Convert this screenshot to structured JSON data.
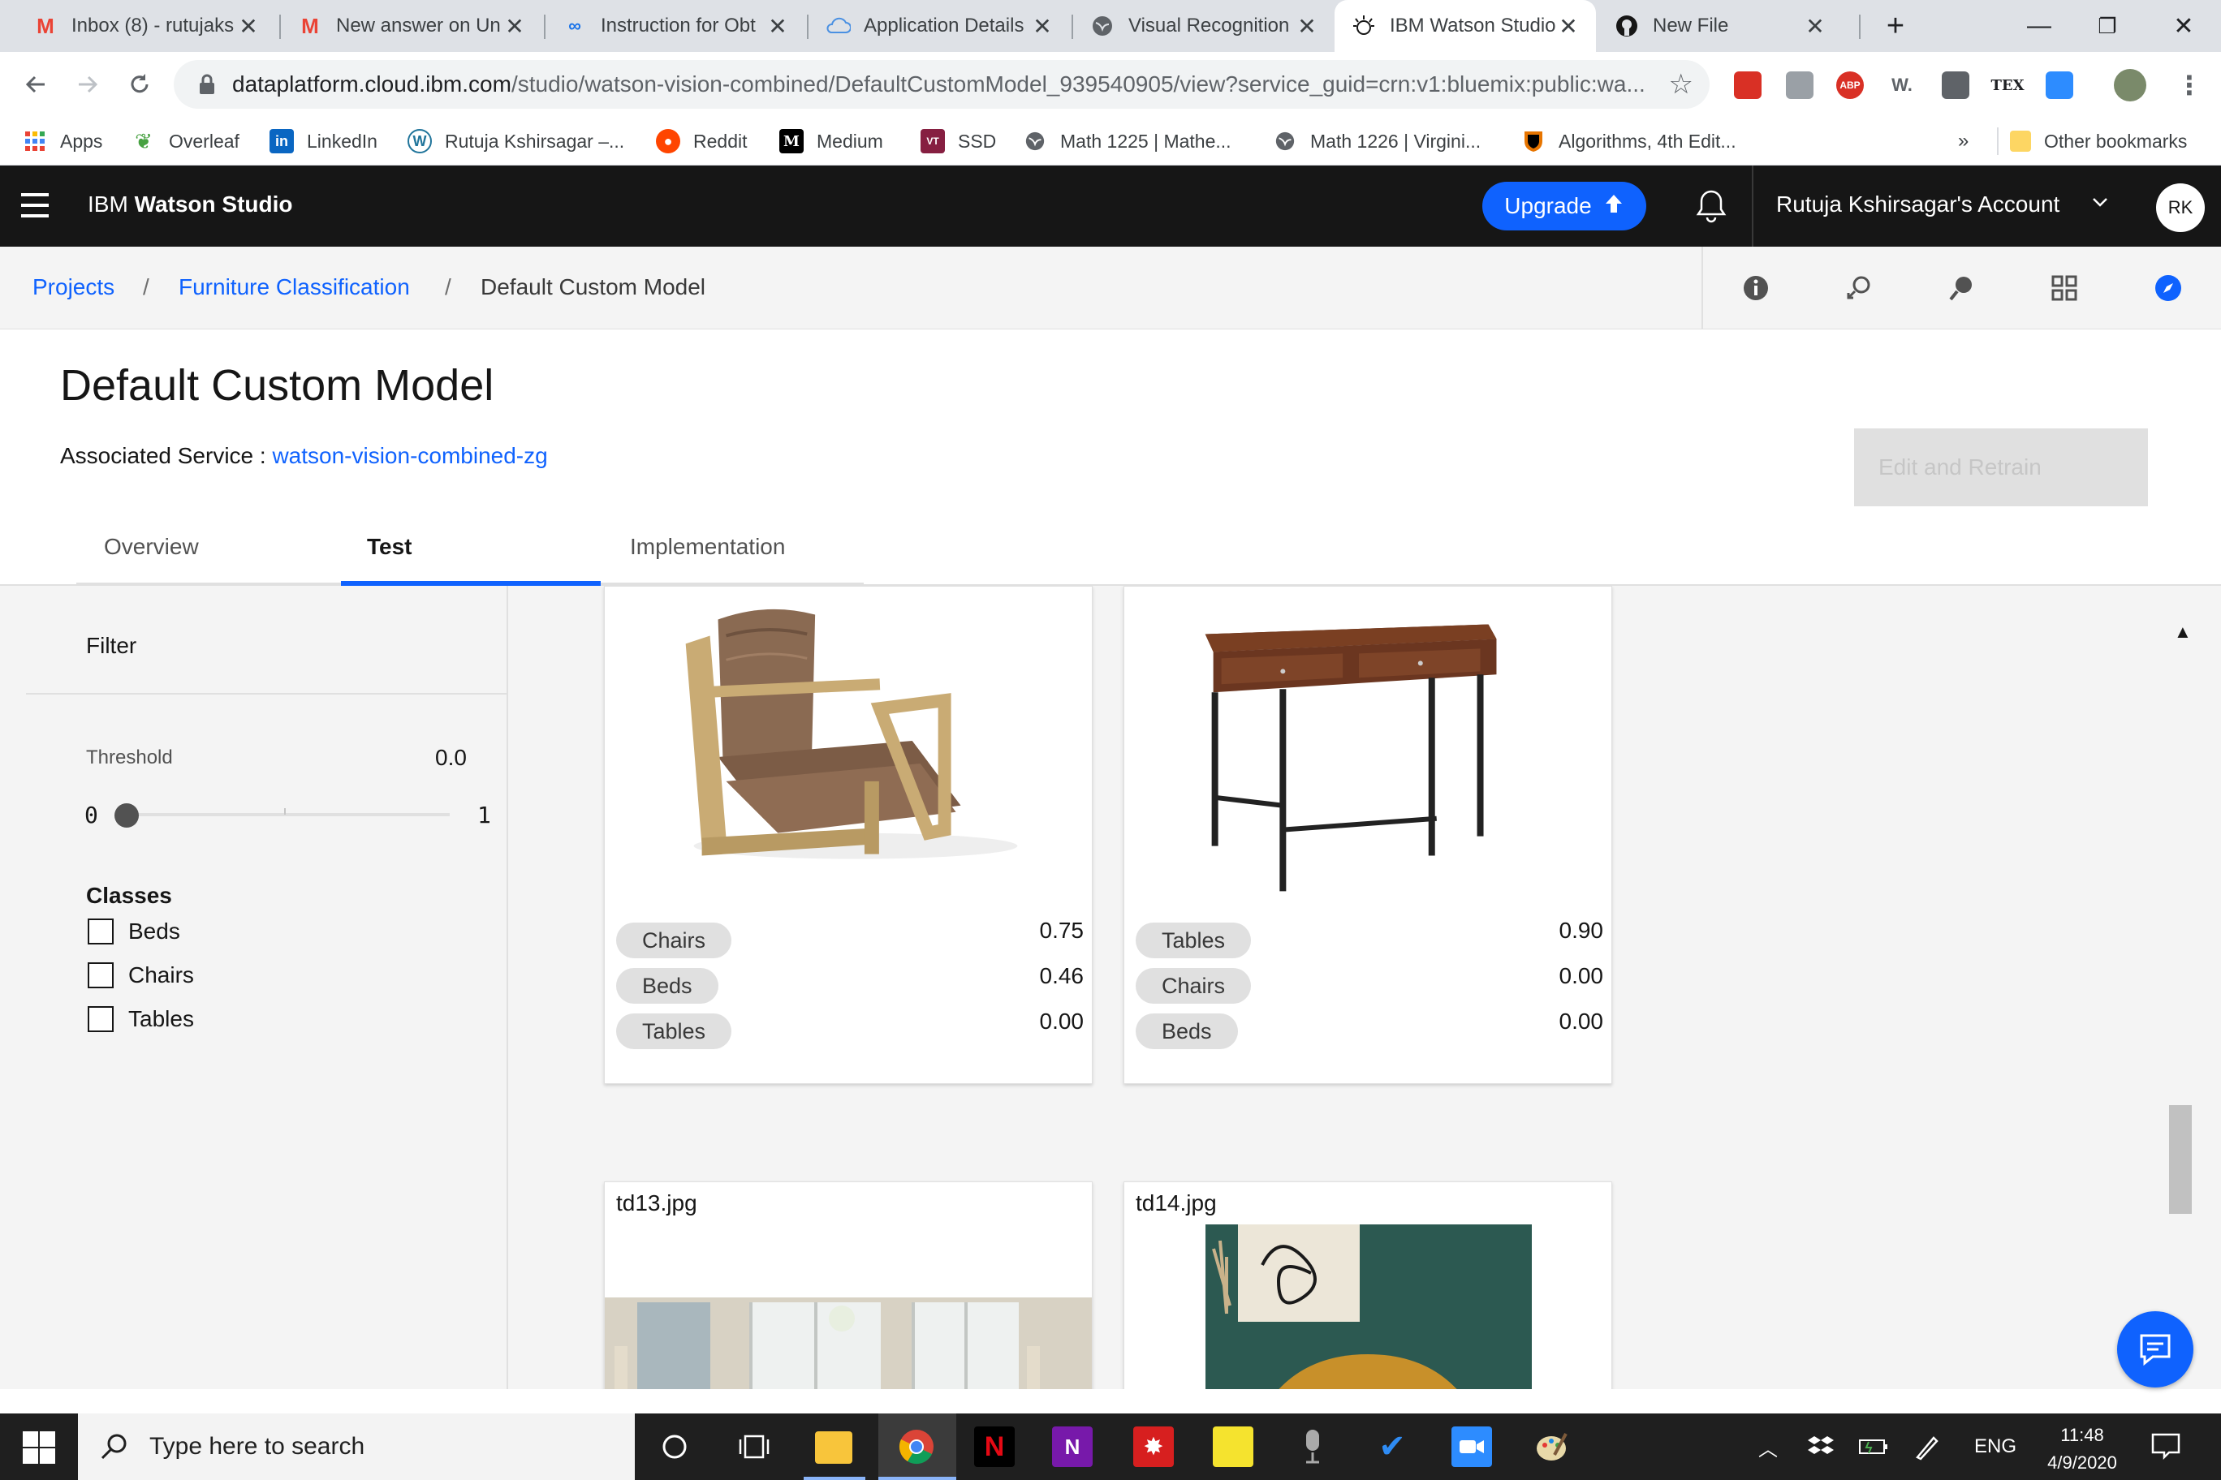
{
  "browser": {
    "tabs": [
      {
        "label": "Inbox (8) - rutujaks",
        "icon": "gmail-icon",
        "active": false
      },
      {
        "label": "New answer on Un",
        "icon": "gmail-icon",
        "active": false
      },
      {
        "label": "Instruction for Obt",
        "icon": "link-icon",
        "active": false
      },
      {
        "label": "Application Details",
        "icon": "cloud-icon",
        "active": false
      },
      {
        "label": "Visual Recognition",
        "icon": "globe-icon",
        "active": false
      },
      {
        "label": "IBM Watson Studio",
        "icon": "watson-icon",
        "active": true
      },
      {
        "label": "New File",
        "icon": "github-icon",
        "active": false
      }
    ],
    "new_tab": "+",
    "window_controls": {
      "minimize": "—",
      "restore": "❐",
      "close": "✕"
    },
    "url_host": "dataplatform.cloud.ibm.com",
    "url_path": "/studio/watson-vision-combined/DefaultCustomModel_939540905/view?service_guid=crn:v1:bluemix:public:wa...",
    "extensions": [
      "ABP",
      "W.",
      "TEX"
    ],
    "bookmarks": [
      {
        "label": "Apps",
        "icon": "apps-grid-icon"
      },
      {
        "label": "Overleaf",
        "icon": "overleaf-icon"
      },
      {
        "label": "LinkedIn",
        "icon": "linkedin-icon"
      },
      {
        "label": "Rutuja Kshirsagar –...",
        "icon": "wordpress-icon"
      },
      {
        "label": "Reddit",
        "icon": "reddit-icon"
      },
      {
        "label": "Medium",
        "icon": "medium-icon"
      },
      {
        "label": "SSD",
        "icon": "vt-icon"
      },
      {
        "label": "Math 1225 | Mathe...",
        "icon": "globe-icon"
      },
      {
        "label": "Math 1226 | Virgini...",
        "icon": "globe-icon"
      },
      {
        "label": "Algorithms, 4th Edit...",
        "icon": "princeton-icon"
      }
    ],
    "bookmarks_overflow": "»",
    "other_bookmarks": "Other bookmarks"
  },
  "header": {
    "brand_prefix": "IBM",
    "brand_name": "Watson Studio",
    "upgrade_label": "Upgrade",
    "account_label": "Rutuja Kshirsagar's Account",
    "avatar_initials": "RK"
  },
  "breadcrumb": {
    "items": [
      "Projects",
      "Furniture Classification",
      "Default Custom Model"
    ],
    "separator": "/"
  },
  "model": {
    "title": "Default Custom Model",
    "assoc_label": "Associated Service : ",
    "assoc_service": "watson-vision-combined-zg",
    "edit_retrain_label": "Edit and Retrain"
  },
  "tabs": [
    {
      "label": "Overview",
      "active": false
    },
    {
      "label": "Test",
      "active": true
    },
    {
      "label": "Implementation",
      "active": false
    }
  ],
  "filter": {
    "title": "Filter",
    "threshold_label": "Threshold",
    "threshold_value": "0.0",
    "threshold_fraction": 0.0,
    "slider_min": "0",
    "slider_max": "1",
    "classes_title": "Classes",
    "classes": [
      "Beds",
      "Chairs",
      "Tables"
    ]
  },
  "results": [
    {
      "image": "armchair",
      "scores": [
        {
          "class": "Chairs",
          "score": "0.75"
        },
        {
          "class": "Beds",
          "score": "0.46"
        },
        {
          "class": "Tables",
          "score": "0.00"
        }
      ]
    },
    {
      "image": "desk",
      "scores": [
        {
          "class": "Tables",
          "score": "0.90"
        },
        {
          "class": "Chairs",
          "score": "0.00"
        },
        {
          "class": "Beds",
          "score": "0.00"
        }
      ]
    },
    {
      "filename": "td13.jpg",
      "image": "dining-room"
    },
    {
      "filename": "td14.jpg",
      "image": "yellow-chair"
    }
  ],
  "taskbar": {
    "search_placeholder": "Type here to search",
    "language": "ENG",
    "time": "11:48",
    "date": "4/9/2020"
  },
  "colors": {
    "ibm_blue": "#0f62fe",
    "header_bg": "#161616",
    "tag_bg": "#e0e0e0"
  }
}
